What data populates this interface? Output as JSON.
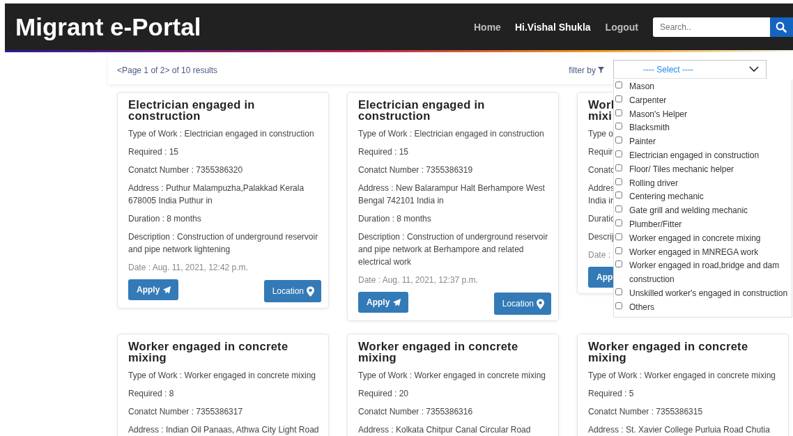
{
  "header": {
    "title": "Migrant e-Portal",
    "nav": [
      {
        "label": "Home",
        "kind": "link"
      },
      {
        "label": "Hi.Vishal Shukla",
        "kind": "user"
      },
      {
        "label": "Logout",
        "kind": "link"
      }
    ],
    "search": {
      "placeholder": "Search.."
    }
  },
  "toolbar": {
    "pagination": "<Page 1 of 2> of 10 results",
    "filter_label": "filter by",
    "select": {
      "value": "---- Select ----",
      "expanded": true
    }
  },
  "filter_options": [
    {
      "label": "Mason",
      "checked": false
    },
    {
      "label": "Carpenter",
      "checked": false
    },
    {
      "label": "Mason's Helper",
      "checked": false
    },
    {
      "label": "Blacksmith",
      "checked": false
    },
    {
      "label": "Painter",
      "checked": false
    },
    {
      "label": "Electrician engaged in construction",
      "checked": false
    },
    {
      "label": "Floor/ Tiles mechanic helper",
      "checked": false
    },
    {
      "label": "Rolling driver",
      "checked": false
    },
    {
      "label": "Centering mechanic",
      "checked": false
    },
    {
      "label": "Gate grill and welding mechanic",
      "checked": false
    },
    {
      "label": "Plumber/Fitter",
      "checked": false
    },
    {
      "label": "Worker engaged in concrete mixing",
      "checked": false
    },
    {
      "label": "Worker engaged in MNREGA work",
      "checked": false
    },
    {
      "label": "Worker engaged in road,bridge and dam construction",
      "checked": false
    },
    {
      "label": "Unskilled worker's engaged in construction",
      "checked": false
    },
    {
      "label": "Others",
      "checked": false
    }
  ],
  "cards": [
    {
      "title": "Electrician engaged in construction",
      "fields": [
        "Type of Work : Electrician engaged in construction",
        "Required : 15",
        "Conatct Number : 7355386320",
        "Address : Puthur Malampuzha,Palakkad Kerala 678005 India Puthur in",
        "Duration : 8 months",
        "Description : Construction of underground reservoir and pipe network lightening"
      ],
      "date": "Date : Aug. 11, 2021, 12:42 p.m.",
      "buttons": [
        {
          "kind": "apply",
          "label": "Apply",
          "icon": true
        },
        {
          "kind": "location",
          "label": "Location",
          "icon": true
        }
      ]
    },
    {
      "title": "Electrician engaged in construction",
      "fields": [
        "Type of Work : Electrician engaged in construction",
        "Required : 15",
        "Conatct Number : 7355386319",
        "Address : New Balarampur Halt Berhampore West Bengal 742101 India in",
        "Duration : 8 months",
        "Description : Construction of underground reservoir and pipe network at Berhampore and related electrical work"
      ],
      "date": "Date : Aug. 11, 2021, 12:37 p.m.",
      "buttons": [
        {
          "kind": "apply",
          "label": "Apply",
          "icon": true
        },
        {
          "kind": "location",
          "label": "Location",
          "icon": true
        }
      ]
    },
    {
      "title": "Worl\nmixi",
      "fields": [
        "Type o",
        "Requir",
        "Conatc",
        "Addres\nIndia ir",
        "Duratic",
        "Descrij"
      ],
      "date": "Date :",
      "buttons": [
        {
          "kind": "apply",
          "label": "App",
          "icon": false
        }
      ]
    },
    {
      "title": "Worker engaged in concrete mixing",
      "fields": [
        "Type of Work : Worker engaged in concrete mixing",
        "Required : 8",
        "Conatct Number : 7355386317",
        "Address : Indian Oil Panaas, Athwa City Light Road"
      ]
    },
    {
      "title": "Worker engaged in concrete mixing",
      "fields": [
        "Type of Work : Worker engaged in concrete mixing",
        "Required : 20",
        "Conatct Number : 7355386316",
        "Address : Kolkata Chitpur Canal Circular Road"
      ]
    },
    {
      "title": "Worker engaged in concrete mixing",
      "fields": [
        "Type of Work : Worker engaged in concrete mixing",
        "Required : 5",
        "Conatct Number : 7355386315",
        "Address : St. Xavier College Purluia Road Chutia"
      ]
    }
  ]
}
